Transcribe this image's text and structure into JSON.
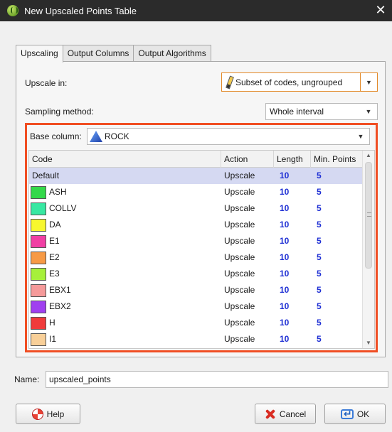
{
  "window": {
    "title": "New Upscaled Points Table",
    "close_glyph": "✕"
  },
  "tabs": [
    {
      "label": "Upscaling",
      "active": true
    },
    {
      "label": "Output Columns",
      "active": false
    },
    {
      "label": "Output Algorithms",
      "active": false
    }
  ],
  "upscale": {
    "label": "Upscale in:",
    "value": "Subset of codes, ungrouped",
    "icon": "pencil-icon"
  },
  "sampling": {
    "label": "Sampling method:",
    "value": "Whole interval"
  },
  "base": {
    "label": "Base column:",
    "value": "ROCK",
    "icon": "rock-column-icon"
  },
  "table": {
    "headers": [
      "Code",
      "Action",
      "Length",
      "Min. Points"
    ],
    "rows": [
      {
        "code": "Default",
        "color": "",
        "action": "Upscale",
        "length": "10",
        "min_points": "5",
        "selected": true
      },
      {
        "code": "ASH",
        "color": "#33d94a",
        "action": "Upscale",
        "length": "10",
        "min_points": "5"
      },
      {
        "code": "COLLV",
        "color": "#38e8a2",
        "action": "Upscale",
        "length": "10",
        "min_points": "5"
      },
      {
        "code": "DA",
        "color": "#f7f72e",
        "action": "Upscale",
        "length": "10",
        "min_points": "5"
      },
      {
        "code": "E1",
        "color": "#f03fa4",
        "action": "Upscale",
        "length": "10",
        "min_points": "5"
      },
      {
        "code": "E2",
        "color": "#f79a45",
        "action": "Upscale",
        "length": "10",
        "min_points": "5"
      },
      {
        "code": "E3",
        "color": "#a6f03a",
        "action": "Upscale",
        "length": "10",
        "min_points": "5"
      },
      {
        "code": "EBX1",
        "color": "#f59a9a",
        "action": "Upscale",
        "length": "10",
        "min_points": "5"
      },
      {
        "code": "EBX2",
        "color": "#a040f0",
        "action": "Upscale",
        "length": "10",
        "min_points": "5"
      },
      {
        "code": "H",
        "color": "#f03b3b",
        "action": "Upscale",
        "length": "10",
        "min_points": "5"
      },
      {
        "code": "I1",
        "color": "#f8cf98",
        "action": "Upscale",
        "length": "10",
        "min_points": "5"
      }
    ]
  },
  "name": {
    "label": "Name:",
    "value": "upscaled_points"
  },
  "buttons": {
    "help": "Help",
    "cancel": "Cancel",
    "ok": "OK"
  },
  "colors": {
    "highlight_border": "#f04e23",
    "selected_row": "#d5d9f2",
    "number_blue": "#1e2fd4",
    "titlebar": "#2b2b2b"
  }
}
